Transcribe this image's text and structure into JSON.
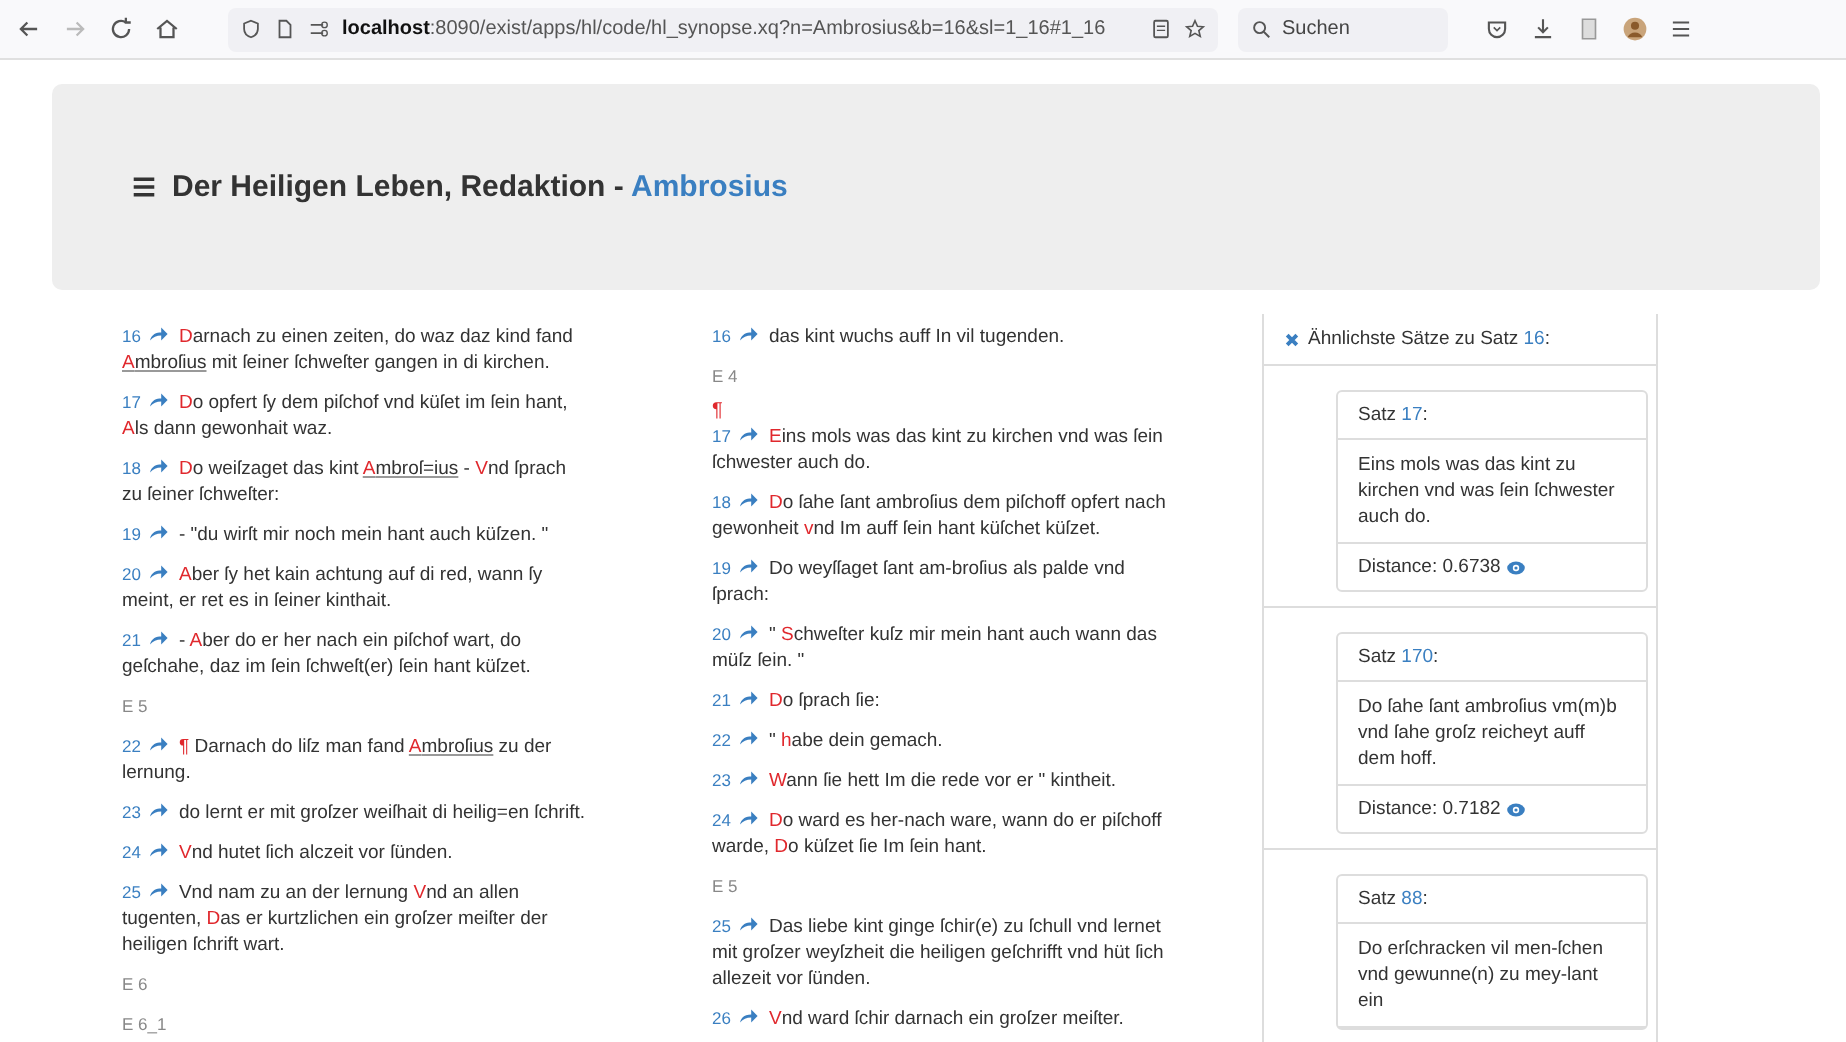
{
  "browser": {
    "url": "**localhost**:8090/exist/apps/hl/code/hl_synopse.xq?n=Ambrosius&b=16&sl=1_16#1_16",
    "search_placeholder": "Suchen"
  },
  "header": {
    "title": "Der Heiligen Leben, Redaktion - ",
    "highlight": "Ambrosius"
  },
  "columns": [
    {
      "items": [
        {
          "kind": "sentence",
          "number": "16",
          "parts": [
            {
              "text": "D",
              "red": true,
              "underline": false
            },
            {
              "text": "arnach zu einen zeiten, do waz daz kind fand ",
              "red": false,
              "underline": false
            },
            {
              "text": "A",
              "red": true,
              "underline": true
            },
            {
              "text": "mbroſius",
              "red": false,
              "underline": true
            },
            {
              "text": " mit ſeiner ſchweſter gangen in di kirchen.",
              "red": false,
              "underline": false
            }
          ]
        },
        {
          "kind": "sentence",
          "number": "17",
          "parts": [
            {
              "text": "D",
              "red": true,
              "underline": false
            },
            {
              "text": "o opfert ſy dem piſchof vnd küſet im ſein hant, ",
              "red": false,
              "underline": false
            },
            {
              "text": "A",
              "red": true,
              "underline": false
            },
            {
              "text": "ls dann gewonhait waz.",
              "red": false,
              "underline": false
            }
          ]
        },
        {
          "kind": "sentence",
          "number": "18",
          "parts": [
            {
              "text": "D",
              "red": true,
              "underline": false
            },
            {
              "text": "o weiſzaget das kint ",
              "red": false,
              "underline": false
            },
            {
              "text": "A",
              "red": true,
              "underline": true
            },
            {
              "text": "mbroſ=ius",
              "red": false,
              "underline": true
            },
            {
              "text": " - ",
              "red": false,
              "underline": false
            },
            {
              "text": "V",
              "red": true,
              "underline": false
            },
            {
              "text": "nd ſprach zu ſeiner ſchweſter:",
              "red": false,
              "underline": false
            }
          ]
        },
        {
          "kind": "sentence",
          "number": "19",
          "parts": [
            {
              "text": "- \"du wirſt mir noch mein hant auch küſzen. \"",
              "red": false,
              "underline": false
            }
          ]
        },
        {
          "kind": "sentence",
          "number": "20",
          "parts": [
            {
              "text": "A",
              "red": true,
              "underline": false
            },
            {
              "text": "ber ſy het kain achtung auf di red, wann ſy meint, er ret es in ſeiner kinthait.",
              "red": false,
              "underline": false
            }
          ]
        },
        {
          "kind": "sentence",
          "number": "21",
          "parts": [
            {
              "text": "- ",
              "red": false,
              "underline": false
            },
            {
              "text": "A",
              "red": true,
              "underline": false
            },
            {
              "text": "ber do er her nach ein piſchof wart, do geſchahe, daz im ſein ſchweſt(er) ſein hant küſzet.",
              "red": false,
              "underline": false
            }
          ]
        },
        {
          "kind": "marker",
          "text": "E 5"
        },
        {
          "kind": "sentence",
          "number": "22",
          "parts": [
            {
              "text": "¶",
              "red": true,
              "underline": false
            },
            {
              "text": " Darnach do liſz man fand ",
              "red": false,
              "underline": false
            },
            {
              "text": "A",
              "red": true,
              "underline": true
            },
            {
              "text": "mbroſius",
              "red": false,
              "underline": true
            },
            {
              "text": " zu der lernung.",
              "red": false,
              "underline": false
            }
          ]
        },
        {
          "kind": "sentence",
          "number": "23",
          "parts": [
            {
              "text": "do lernt er mit groſzer weiſhait di heilig=en ſchrift.",
              "red": false,
              "underline": false
            }
          ]
        },
        {
          "kind": "sentence",
          "number": "24",
          "parts": [
            {
              "text": "V",
              "red": true,
              "underline": false
            },
            {
              "text": "nd hutet ſich alczeit vor ſünden.",
              "red": false,
              "underline": false
            }
          ]
        },
        {
          "kind": "sentence",
          "number": "25",
          "parts": [
            {
              "text": "Vnd nam zu an der lernung ",
              "red": false,
              "underline": false
            },
            {
              "text": "V",
              "red": true,
              "underline": false
            },
            {
              "text": "nd an allen tugenten, ",
              "red": false,
              "underline": false
            },
            {
              "text": "D",
              "red": true,
              "underline": false
            },
            {
              "text": "as er kurtzlichen ein groſzer meiſter der heiligen ſchrift wart.",
              "red": false,
              "underline": false
            }
          ]
        },
        {
          "kind": "marker",
          "text": "E 6"
        },
        {
          "kind": "marker",
          "text": "E 6_1"
        }
      ]
    },
    {
      "items": [
        {
          "kind": "sentence",
          "number": "16",
          "parts": [
            {
              "text": "das kint wuchs auff In vil tugenden.",
              "red": false,
              "underline": false
            }
          ]
        },
        {
          "kind": "marker",
          "text": "E 4"
        },
        {
          "kind": "pilcrow",
          "text": "¶"
        },
        {
          "kind": "sentence",
          "number": "17",
          "parts": [
            {
              "text": "E",
              "red": true,
              "underline": false
            },
            {
              "text": "ins mols was das kint zu kirchen vnd was ſein ſchwester auch do.",
              "red": false,
              "underline": false
            }
          ]
        },
        {
          "kind": "sentence",
          "number": "18",
          "parts": [
            {
              "text": "D",
              "red": true,
              "underline": false
            },
            {
              "text": "o ſahe ſant ambroſius dem piſchoff opfert nach gewonheit ",
              "red": false,
              "underline": false
            },
            {
              "text": "v",
              "red": true,
              "underline": false
            },
            {
              "text": "nd Im auff ſein hant küſchet küſzet.",
              "red": false,
              "underline": false
            }
          ]
        },
        {
          "kind": "sentence",
          "number": "19",
          "parts": [
            {
              "text": "Do weyſſaget ſant am-broſius als palde vnd ſprach:",
              "red": false,
              "underline": false
            }
          ]
        },
        {
          "kind": "sentence",
          "number": "20",
          "parts": [
            {
              "text": "\" ",
              "red": false,
              "underline": false
            },
            {
              "text": "S",
              "red": true,
              "underline": false
            },
            {
              "text": "chweſter kuſz mir mein hant auch wann das müſz ſein. \"",
              "red": false,
              "underline": false
            }
          ]
        },
        {
          "kind": "sentence",
          "number": "21",
          "parts": [
            {
              "text": "D",
              "red": true,
              "underline": false
            },
            {
              "text": "o ſprach ſie:",
              "red": false,
              "underline": false
            }
          ]
        },
        {
          "kind": "sentence",
          "number": "22",
          "parts": [
            {
              "text": "\" ",
              "red": false,
              "underline": false
            },
            {
              "text": "h",
              "red": true,
              "underline": false
            },
            {
              "text": "abe dein gemach.",
              "red": false,
              "underline": false
            }
          ]
        },
        {
          "kind": "sentence",
          "number": "23",
          "parts": [
            {
              "text": "W",
              "red": true,
              "underline": false
            },
            {
              "text": "ann ſie hett Im die rede vor er \" kintheit.",
              "red": false,
              "underline": false
            }
          ]
        },
        {
          "kind": "sentence",
          "number": "24",
          "parts": [
            {
              "text": "D",
              "red": true,
              "underline": false
            },
            {
              "text": "o ward es her-nach ware, wann do er piſchoff warde, ",
              "red": false,
              "underline": false
            },
            {
              "text": "D",
              "red": true,
              "underline": false
            },
            {
              "text": "o küſzet ſie Im ſein hant.",
              "red": false,
              "underline": false
            }
          ]
        },
        {
          "kind": "marker",
          "text": "E 5"
        },
        {
          "kind": "sentence",
          "number": "25",
          "parts": [
            {
              "text": "Das liebe kint ginge ſchir(e) zu ſchull vnd lernet mit groſzer weyſzheit die heiligen geſchrifft vnd hüt ſich allezeit vor ſünden.",
              "red": false,
              "underline": false
            }
          ]
        },
        {
          "kind": "sentence",
          "number": "26",
          "parts": [
            {
              "text": "V",
              "red": true,
              "underline": false
            },
            {
              "text": "nd ward ſchir darnach ein groſzer meiſter.",
              "red": false,
              "underline": false
            }
          ]
        }
      ]
    }
  ],
  "similar": {
    "heading": "Ähnlichste Sätze zu Satz ",
    "satz": "16",
    "suffix": ":",
    "cards": [
      {
        "label": "Satz",
        "satz": "17",
        "suffix": ":",
        "text": "Eins mols was das kint zu kirchen vnd was ſein ſchwester auch do.",
        "distance_label": "Distance:",
        "distance": "0.6738"
      },
      {
        "label": "Satz",
        "satz": "170",
        "suffix": ":",
        "text": "Do ſahe ſant ambroſius vm(m)b vnd ſahe groſz reicheyt auff dem hoff.",
        "distance_label": "Distance:",
        "distance": "0.7182"
      },
      {
        "label": "Satz",
        "satz": "88",
        "suffix": ":",
        "text": "Do erſchracken vil men-ſchen vnd gewunne(n) zu mey-lant ein"
      }
    ]
  }
}
